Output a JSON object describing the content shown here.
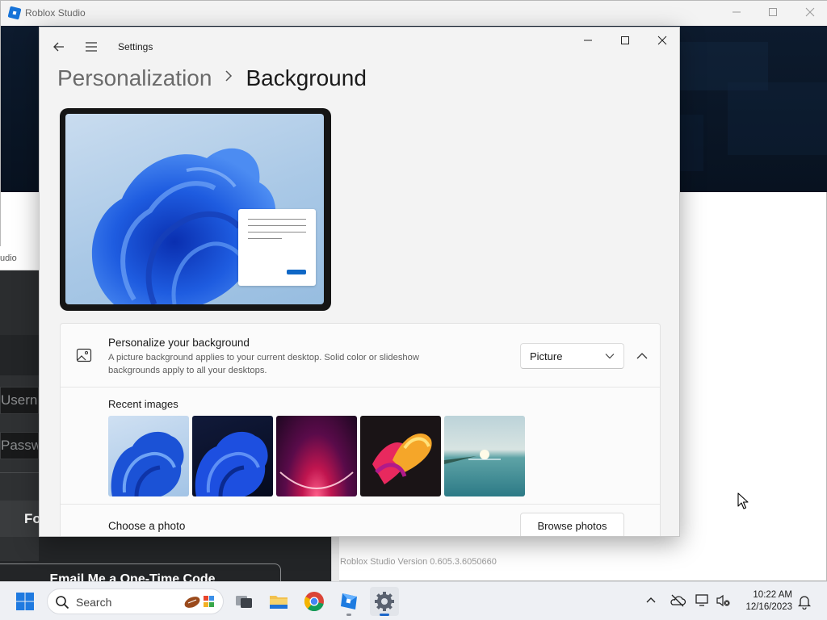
{
  "roblox_window": {
    "title": "Roblox Studio",
    "version_text": "Roblox Studio Version 0.605.3.6050660"
  },
  "roblox_login": {
    "title_fragment": "udio",
    "username_fragment": "Userna",
    "password_fragment": "Passwo",
    "login_button_fragment": "Fo",
    "one_time_code_button": "Email Me a One-Time Code"
  },
  "settings": {
    "app_title": "Settings",
    "breadcrumb": {
      "parent": "Personalization",
      "current": "Background"
    },
    "personalize": {
      "heading": "Personalize your background",
      "description": "A picture background applies to your current desktop. Solid color or slideshow backgrounds apply to all your desktops.",
      "dropdown_value": "Picture"
    },
    "recent_images": {
      "heading": "Recent images",
      "items": [
        {
          "name": "blue bloom light"
        },
        {
          "name": "blue bloom dark"
        },
        {
          "name": "purple glow"
        },
        {
          "name": "colorful ribbon"
        },
        {
          "name": "lake sunrise"
        }
      ]
    },
    "choose_photo": {
      "heading": "Choose a photo",
      "button": "Browse photos"
    }
  },
  "taskbar": {
    "search_placeholder": "Search",
    "apps": [
      "task-view",
      "file-explorer",
      "chrome",
      "roblox-studio",
      "settings"
    ],
    "active_app": "settings",
    "clock": {
      "time": "10:22 AM",
      "date": "12/16/2023"
    }
  },
  "colors": {
    "accent": "#0f67c6",
    "taskbar_indicator": "#1d67c9",
    "login_background": "#232527"
  }
}
